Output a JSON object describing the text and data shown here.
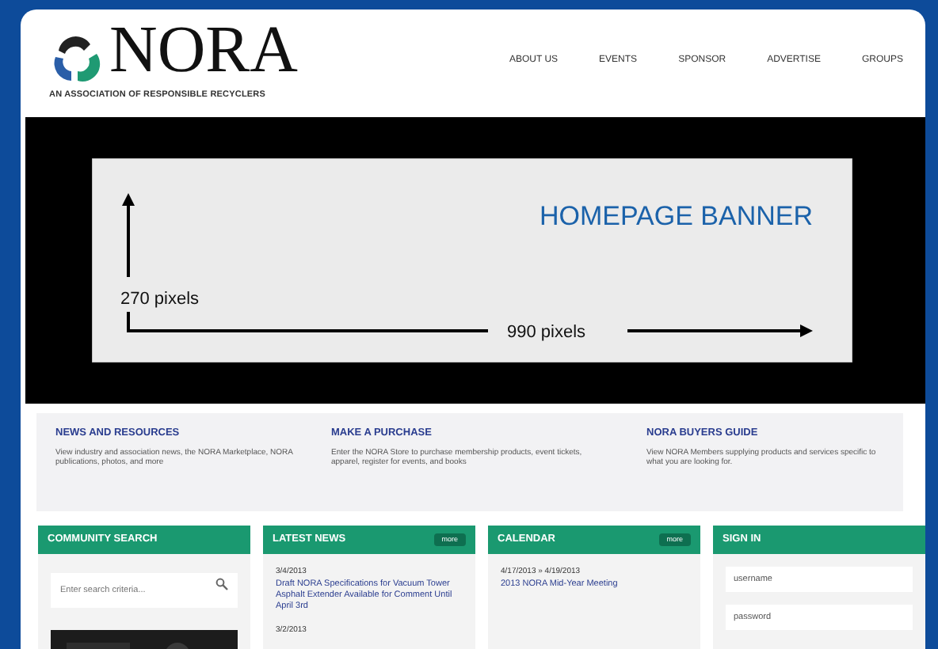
{
  "header": {
    "logo": "NORA",
    "tagline": "AN ASSOCIATION OF RESPONSIBLE RECYCLERS",
    "nav": [
      {
        "label": "ABOUT US"
      },
      {
        "label": "EVENTS"
      },
      {
        "label": "SPONSOR"
      },
      {
        "label": "ADVERTISE"
      },
      {
        "label": "GROUPS"
      }
    ]
  },
  "banner": {
    "title": "HOMEPAGE BANNER",
    "height_label": "270 pixels",
    "width_label": "990 pixels"
  },
  "features": [
    {
      "title": "NEWS AND RESOURCES",
      "text": "View industry and association news, the NORA Marketplace, NORA publications, photos, and more"
    },
    {
      "title": "MAKE A PURCHASE",
      "text": "Enter the NORA Store to purchase membership products, event tickets, apparel, register for events, and books"
    },
    {
      "title": "NORA BUYERS GUIDE",
      "text": "View NORA Members supplying products and services specific to what you are looking for."
    }
  ],
  "panels": [
    {
      "kind": "search",
      "title": "COMMUNITY SEARCH",
      "placeholder": "Enter search criteria..."
    },
    {
      "kind": "list",
      "title": "LATEST NEWS",
      "more": "more",
      "items": [
        {
          "date": "3/4/2013",
          "link": "Draft NORA Specifications for Vacuum Tower Asphalt Extender Available for Comment Until April 3rd"
        },
        {
          "date": "3/2/2013"
        }
      ]
    },
    {
      "kind": "list",
      "title": "CALENDAR",
      "more": "more",
      "items": [
        {
          "date": "4/17/2013 » 4/19/2013",
          "link": "2013 NORA Mid-Year Meeting"
        }
      ]
    },
    {
      "kind": "signin",
      "title": "SIGN IN",
      "fields": [
        {
          "placeholder": "username"
        },
        {
          "placeholder": "password"
        }
      ]
    }
  ]
}
